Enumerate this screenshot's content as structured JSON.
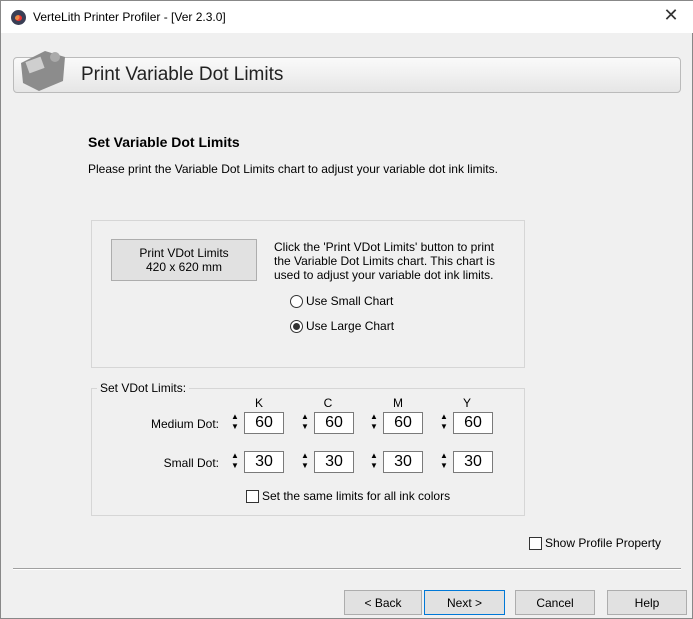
{
  "window": {
    "title": "VerteLith Printer Profiler - [Ver 2.3.0]",
    "close": "✕"
  },
  "header": {
    "title": "Print Variable Dot Limits"
  },
  "section": {
    "heading": "Set Variable Dot Limits",
    "description": "Please print the Variable Dot Limits chart to adjust your variable dot ink limits."
  },
  "print": {
    "button_line1": "Print VDot Limits",
    "button_line2": "420 x 620 mm",
    "info": "Click the 'Print VDot Limits' button to print the Variable Dot Limits chart. This chart is used to adjust your variable dot ink limits.",
    "radio_small": "Use Small Chart",
    "radio_large": "Use Large Chart",
    "selected": "large"
  },
  "vdot": {
    "legend": "Set VDot Limits:",
    "columns": [
      "K",
      "C",
      "M",
      "Y"
    ],
    "medium_label": "Medium Dot:",
    "small_label": "Small Dot:",
    "medium": [
      "60",
      "60",
      "60",
      "60"
    ],
    "small": [
      "30",
      "30",
      "30",
      "30"
    ],
    "same_limits": "Set the same limits for all ink colors"
  },
  "show_profile": "Show Profile Property",
  "buttons": {
    "back": "< Back",
    "next": "Next >",
    "cancel": "Cancel",
    "help": "Help"
  }
}
